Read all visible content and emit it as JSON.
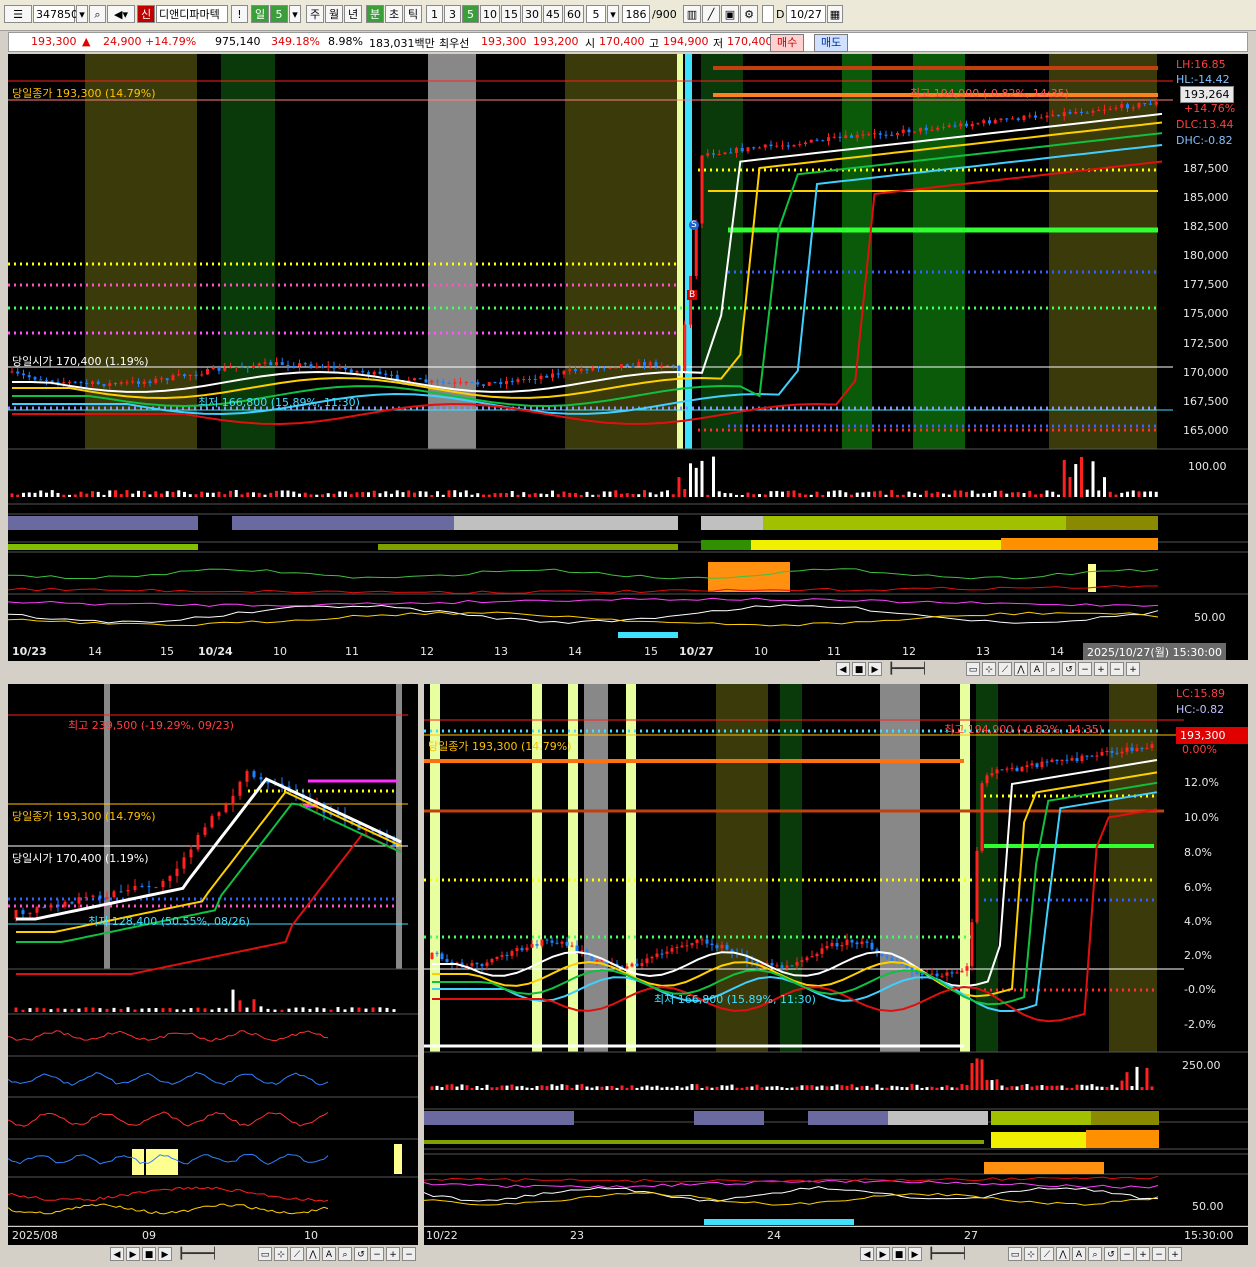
{
  "toolbar": {
    "code": "347850",
    "new_badge": "신",
    "stock_name": "디앤디파마텍",
    "excl": "!",
    "period_buttons": [
      "일",
      "5",
      "주",
      "월",
      "년",
      "분",
      "초",
      "틱"
    ],
    "minute_buttons": [
      "1",
      "3",
      "5",
      "10",
      "15",
      "30",
      "45",
      "60"
    ],
    "count_value": "5",
    "count_text": "186",
    "max_text": "/900",
    "date_check": "D",
    "date_value": "10/27"
  },
  "quote": {
    "price": "193,300",
    "arrow": "▲",
    "change": "24,900",
    "change_pct": "+14.79%",
    "volume": "975,140",
    "vol_ratio": "349.18%",
    "turnover": "8.98%",
    "amount": "183,031백만",
    "best_label": "최우선",
    "best_ask": "193,300",
    "best_bid": "193,200",
    "open_label": "시",
    "open": "170,400",
    "high_label": "고",
    "high": "194,900",
    "low_label": "저",
    "low": "170,400",
    "buy_button": "매수",
    "sell_button": "매도"
  },
  "top_chart": {
    "prev_close_label": "당일종가 193,300 (14.79%)",
    "open_label": "당일시가 170,400 (1.19%)",
    "low_label": "최저 166,800 (15.89%, 11:30)",
    "high_label": "최고 194,900 (-0.82%, 14:35)",
    "right_labels": [
      "LH:16.85",
      "HL:-14.42",
      "DLC:13.44",
      "DHC:-0.82"
    ],
    "price_box": "193,264",
    "price_box_pct": "+14.76%",
    "y_ticks": [
      "187,500",
      "185,000",
      "182,500",
      "180,000",
      "177,500",
      "175,000",
      "172,500",
      "170,000",
      "167,500",
      "165,000"
    ],
    "vol_tick": "100.00",
    "osc_tick": "50.00",
    "x_ticks": [
      "10/23",
      "14",
      "15",
      "10/24",
      "10",
      "11",
      "12",
      "13",
      "14",
      "15",
      "10/27",
      "10",
      "11",
      "12",
      "13",
      "14"
    ],
    "datetime": "2025/10/27(월) 15:30:00",
    "b_marker": "B",
    "s_marker": "S"
  },
  "bottom_left_chart": {
    "high_label": "최고 239,500 (-19.29%, 09/23)",
    "close_label": "당일종가 193,300 (14.79%)",
    "open_label": "당일시가 170,400 (1.19%)",
    "low_label": "최저 128,400 (50.55%, 08/26)",
    "x_ticks": [
      "2025/08",
      "09",
      "10"
    ]
  },
  "bottom_right_chart": {
    "close_label": "당일종가 193,300 (14.79%)",
    "low_label": "최저 166,800 (15.89%, 11:30)",
    "high_label": "최고 194,900 (-0.82%, 14:35)",
    "right_labels": [
      "LC:15.89",
      "HC:-0.82"
    ],
    "price_box": "193,300",
    "price_box_pct": "0.00%",
    "y_ticks": [
      "12.0%",
      "10.0%",
      "8.0%",
      "6.0%",
      "4.0%",
      "2.0%",
      "-0.0%",
      "-2.0%"
    ],
    "vol_tick": "250.00",
    "osc_tick": "50.00",
    "x_ticks": [
      "10/22",
      "23",
      "24",
      "27"
    ],
    "time": "15:30:00"
  },
  "colors": {
    "up": "#ff2020",
    "down": "#2080ff",
    "ma_white": "#ffffff",
    "ma_yellow": "#ffd000",
    "ma_red": "#e01010",
    "ma_cyan": "#40d0ff",
    "band_green": "#10c040",
    "band_pink": "#ff90d0"
  }
}
